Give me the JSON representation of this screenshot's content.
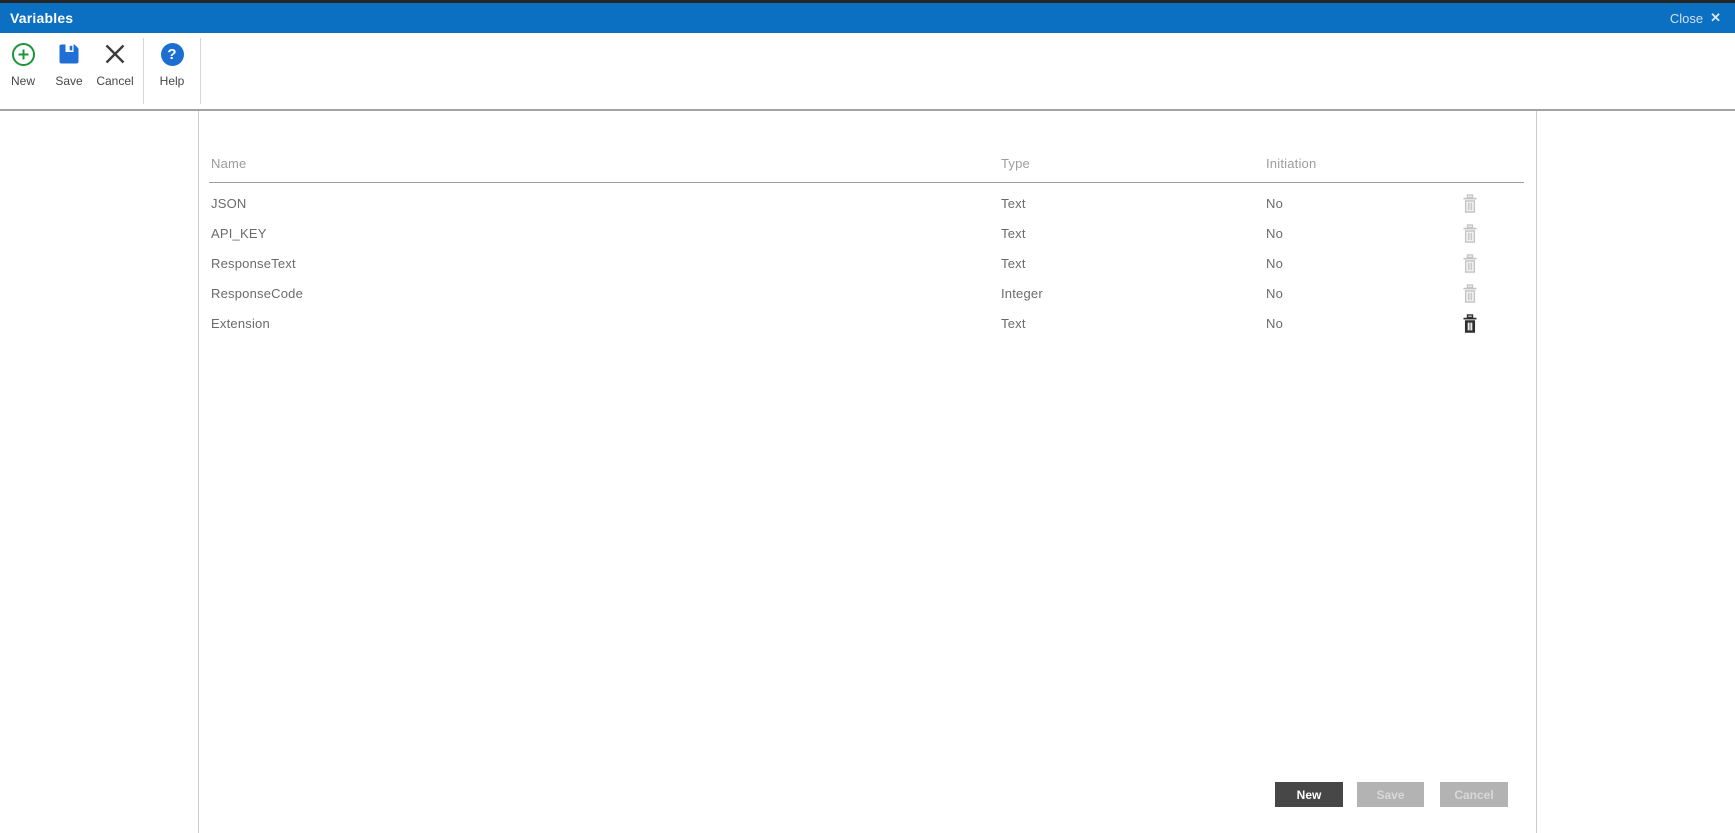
{
  "window": {
    "title": "Variables",
    "close_label": "Close",
    "close_icon": "✕"
  },
  "toolbar": {
    "items": [
      {
        "label": "New",
        "icon": "plus-circle-icon"
      },
      {
        "label": "Save",
        "icon": "floppy-disk-icon"
      },
      {
        "label": "Cancel",
        "icon": "x-icon"
      },
      {
        "label": "Help",
        "icon": "question-circle-icon"
      }
    ],
    "help_glyph": "?"
  },
  "table": {
    "columns": [
      {
        "label": "Name"
      },
      {
        "label": "Type"
      },
      {
        "label": "Initiation"
      }
    ],
    "rows": [
      {
        "name": "JSON",
        "type": "Text",
        "initiation": "No"
      },
      {
        "name": "API_KEY",
        "type": "Text",
        "initiation": "No"
      },
      {
        "name": "ResponseText",
        "type": "Text",
        "initiation": "No"
      },
      {
        "name": "ResponseCode",
        "type": "Integer",
        "initiation": "No"
      },
      {
        "name": "Extension",
        "type": "Text",
        "initiation": "No"
      }
    ],
    "row_action_icon": "trash-icon"
  },
  "footer": {
    "buttons": [
      {
        "label": "New",
        "state": "enabled"
      },
      {
        "label": "Save",
        "state": "disabled"
      },
      {
        "label": "Cancel",
        "state": "disabled"
      }
    ]
  },
  "colors": {
    "titlebar_blue": "#0b70c2",
    "icon_green": "#1d9638",
    "icon_blue": "#1f6fd4",
    "dark_button": "#474747",
    "disabled_button": "#b3b3b3",
    "row_text": "#6b6b6b",
    "header_text": "#9c9c9c"
  }
}
